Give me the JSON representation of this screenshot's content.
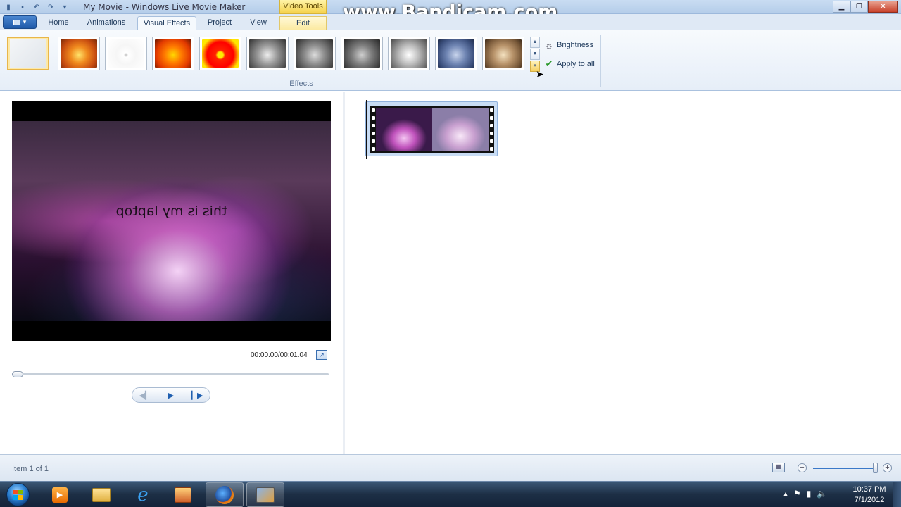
{
  "window": {
    "title": "My Movie - Windows Live Movie Maker",
    "contextual_tab_group": "Video Tools"
  },
  "watermark": "www.Bandicam.com",
  "tabs": [
    {
      "label": "Home",
      "active": false
    },
    {
      "label": "Animations",
      "active": false
    },
    {
      "label": "Visual Effects",
      "active": true
    },
    {
      "label": "Project",
      "active": false
    },
    {
      "label": "View",
      "active": false
    },
    {
      "label": "Edit",
      "active": false
    }
  ],
  "ribbon": {
    "group_label": "Effects",
    "effects": [
      {
        "name": "no-effect",
        "selected": true
      },
      {
        "name": "orange-flower"
      },
      {
        "name": "white-outline-flower"
      },
      {
        "name": "saturated-flower"
      },
      {
        "name": "red-yellow-flower"
      },
      {
        "name": "grayscale-flower-1"
      },
      {
        "name": "grayscale-flower-2"
      },
      {
        "name": "grayscale-flower-3"
      },
      {
        "name": "grayscale-flower-4"
      },
      {
        "name": "cyanotype-flower"
      },
      {
        "name": "sepia-flower"
      }
    ],
    "brightness_label": "Brightness",
    "apply_all_label": "Apply to all"
  },
  "preview": {
    "caption": "this is my laptop",
    "timecode": "00:00.00/00:01.04",
    "position": 0
  },
  "status": {
    "item_text": "Item 1 of 1"
  },
  "taskbar": {
    "time": "10:37 PM",
    "date": "7/1/2012"
  },
  "colors": {
    "ribbon_bg": "#e6eef8",
    "accent": "#1f5aa9",
    "selection": "#e8b64a"
  }
}
